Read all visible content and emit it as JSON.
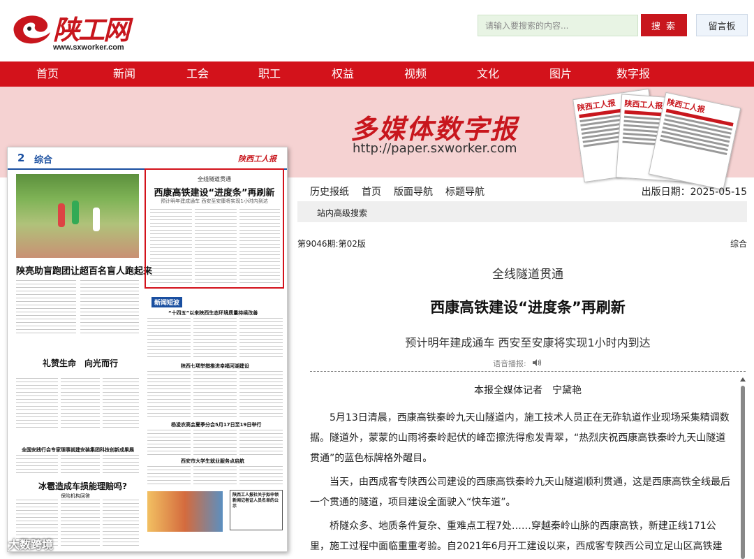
{
  "header": {
    "logo_text": "陕工网",
    "logo_url": "www.sxworker.com",
    "search_placeholder": "请输入要搜索的内容...",
    "search_button": "搜 索",
    "message_board": "留言板"
  },
  "nav": {
    "items": [
      "首页",
      "新闻",
      "工会",
      "职工",
      "权益",
      "视频",
      "文化",
      "图片",
      "数字报"
    ]
  },
  "banner": {
    "title": "多媒体数字报",
    "url": "http://paper.sxworker.com",
    "paper_masthead": "陕西工人报"
  },
  "left_paper": {
    "page_number": "2",
    "section": "综合",
    "masthead": "陕西工人报",
    "lead_headline": "陕亮助盲跑团让超百名盲人跑起来",
    "box_pre_title": "全线隧道贯通",
    "box_title": "西康高铁建设“进度条”再刷新",
    "box_subtitle": "预计明年建成通车 西安至安康将实现1小时内到达",
    "sub1": "礼赞生命　向光而行",
    "sub2": "全国安践行会专家理事就建安装集团科技创新成果展",
    "sub3": "冰雹造成车损能理赔吗?",
    "sub3b": "保险机构回答",
    "sub4": "“十四五”以来陕西生态环境质量持续改善",
    "sub5": "陕西七项举措推进幸福河湖建设",
    "sub6": "杨凌农高会夏季分会5月17日至19日举行",
    "sub7": "西安市大学生就业服务点启航",
    "notice": "陕西工人报社关于拟申领新闻记者证人员名单的公示",
    "column_tag": "新闻短波"
  },
  "watermark": "大数跨境",
  "toolbar": {
    "links": [
      "历史报纸",
      "首页",
      "版面导航",
      "标题导航"
    ],
    "date_label": "出版日期：2025-05-15",
    "advanced_search": "站内高级搜索"
  },
  "article": {
    "issue": "第9046期:第02版",
    "section": "综合",
    "pre_title": "全线隧道贯通",
    "title": "西康高铁建设“进度条”再刷新",
    "subtitle": "预计明年建成通车 西安至安康将实现1小时内到达",
    "voice_label": "语音播报:",
    "byline": "本报全媒体记者　宁黛艳",
    "paragraphs": [
      "5月13日清晨，西康高铁秦岭九天山隧道内，施工技术人员正在无砟轨道作业现场采集精调数据。隧道外，蒙蒙的山雨将秦岭起伏的峰峦擦洗得愈发青翠，“热烈庆祝西康高铁秦岭九天山隧道贯通”的蓝色标牌格外醒目。",
      "当天，由西成客专陕西公司建设的西康高铁秦岭九天山隧道顺利贯通，这是西康高铁全线最后一个贯通的隧道，项目建设全面驶入“快车道”。",
      "桥隧众多、地质条件复杂、重难点工程7处……穿越秦岭山脉的西康高铁，新建正线171公里，施工过程中面临重重考验。自2021年6月开工建设以来，西成客专陕西公司立足山区高铁建"
    ]
  },
  "colors": {
    "brand_red": "#d3121b",
    "banner_pink": "#f5d2d2",
    "search_green": "#e8f4e4",
    "paper_blue": "#1a4fa0"
  }
}
